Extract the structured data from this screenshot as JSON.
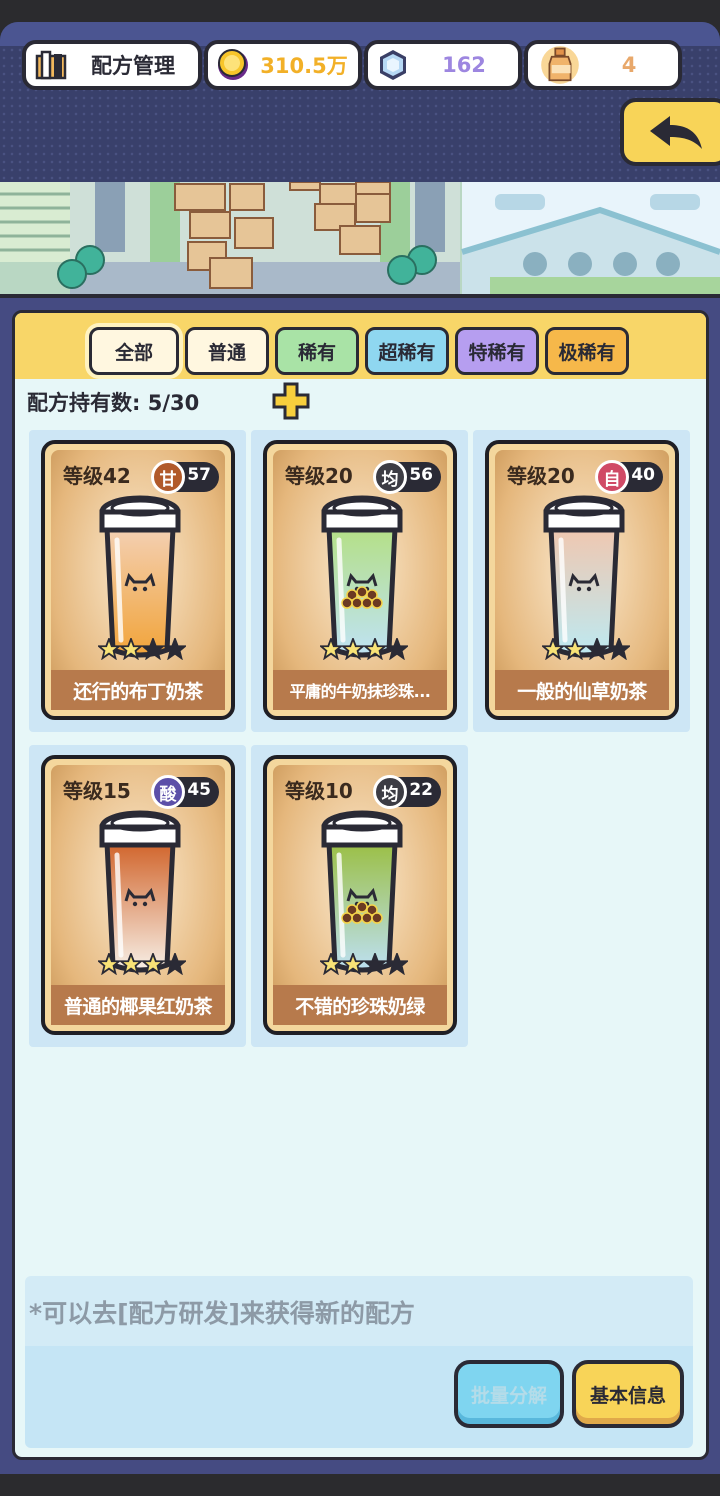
{
  "header": {
    "recipe_mgmt_label": "配方管理",
    "coins": "310.5万",
    "gems": "162",
    "bottles": "4"
  },
  "colors": {
    "gold": "#f2b027",
    "gem": "#9d86e0",
    "bottle": "#e8a86b"
  },
  "tabs": [
    {
      "label": "全部",
      "color": "#fff7e0"
    },
    {
      "label": "普通",
      "color": "#fff7e0"
    },
    {
      "label": "稀有",
      "color": "#a9e3a6"
    },
    {
      "label": "超稀有",
      "color": "#8fd7f0"
    },
    {
      "label": "特稀有",
      "color": "#b69ef0"
    },
    {
      "label": "极稀有",
      "color": "#f6b84a"
    }
  ],
  "holding": {
    "label": "配方持有数:",
    "value": "5/30"
  },
  "cards": [
    {
      "level": "等级42",
      "taste": "甘",
      "taste_color": "#b15a2a",
      "taste_value": "57",
      "name": "还行的布丁奶茶",
      "stars": 2,
      "liquid_top": "#f3d0b3",
      "liquid_bottom": "#f2a43a",
      "pearls": false
    },
    {
      "level": "等级20",
      "taste": "均",
      "taste_color": "#3c3c44",
      "taste_value": "56",
      "name": "平庸的牛奶抹珍珠...",
      "stars": 3,
      "liquid_top": "#b4df86",
      "liquid_bottom": "#bfe3f4",
      "pearls": true
    },
    {
      "level": "等级20",
      "taste": "自",
      "taste_color": "#d04a66",
      "taste_value": "40",
      "name": "一般的仙草奶茶",
      "stars": 2,
      "liquid_top": "#f0c7b0",
      "liquid_bottom": "#bde9f1",
      "pearls": false
    },
    {
      "level": "等级15",
      "taste": "酸",
      "taste_color": "#5c4fa8",
      "taste_value": "45",
      "name": "普通的椰果红奶茶",
      "stars": 3,
      "liquid_top": "#d1652c",
      "liquid_bottom": "#f7efe6",
      "pearls": false
    },
    {
      "level": "等级10",
      "taste": "均",
      "taste_color": "#3c3c44",
      "taste_value": "22",
      "name": "不错的珍珠奶绿",
      "stars": 2,
      "liquid_top": "#9bbf45",
      "liquid_bottom": "#bde0f2",
      "pearls": true
    }
  ],
  "footer": {
    "hint": "*可以去[配方研发]来获得新的配方",
    "batch_label": "批量分解",
    "info_label": "基本信息"
  }
}
